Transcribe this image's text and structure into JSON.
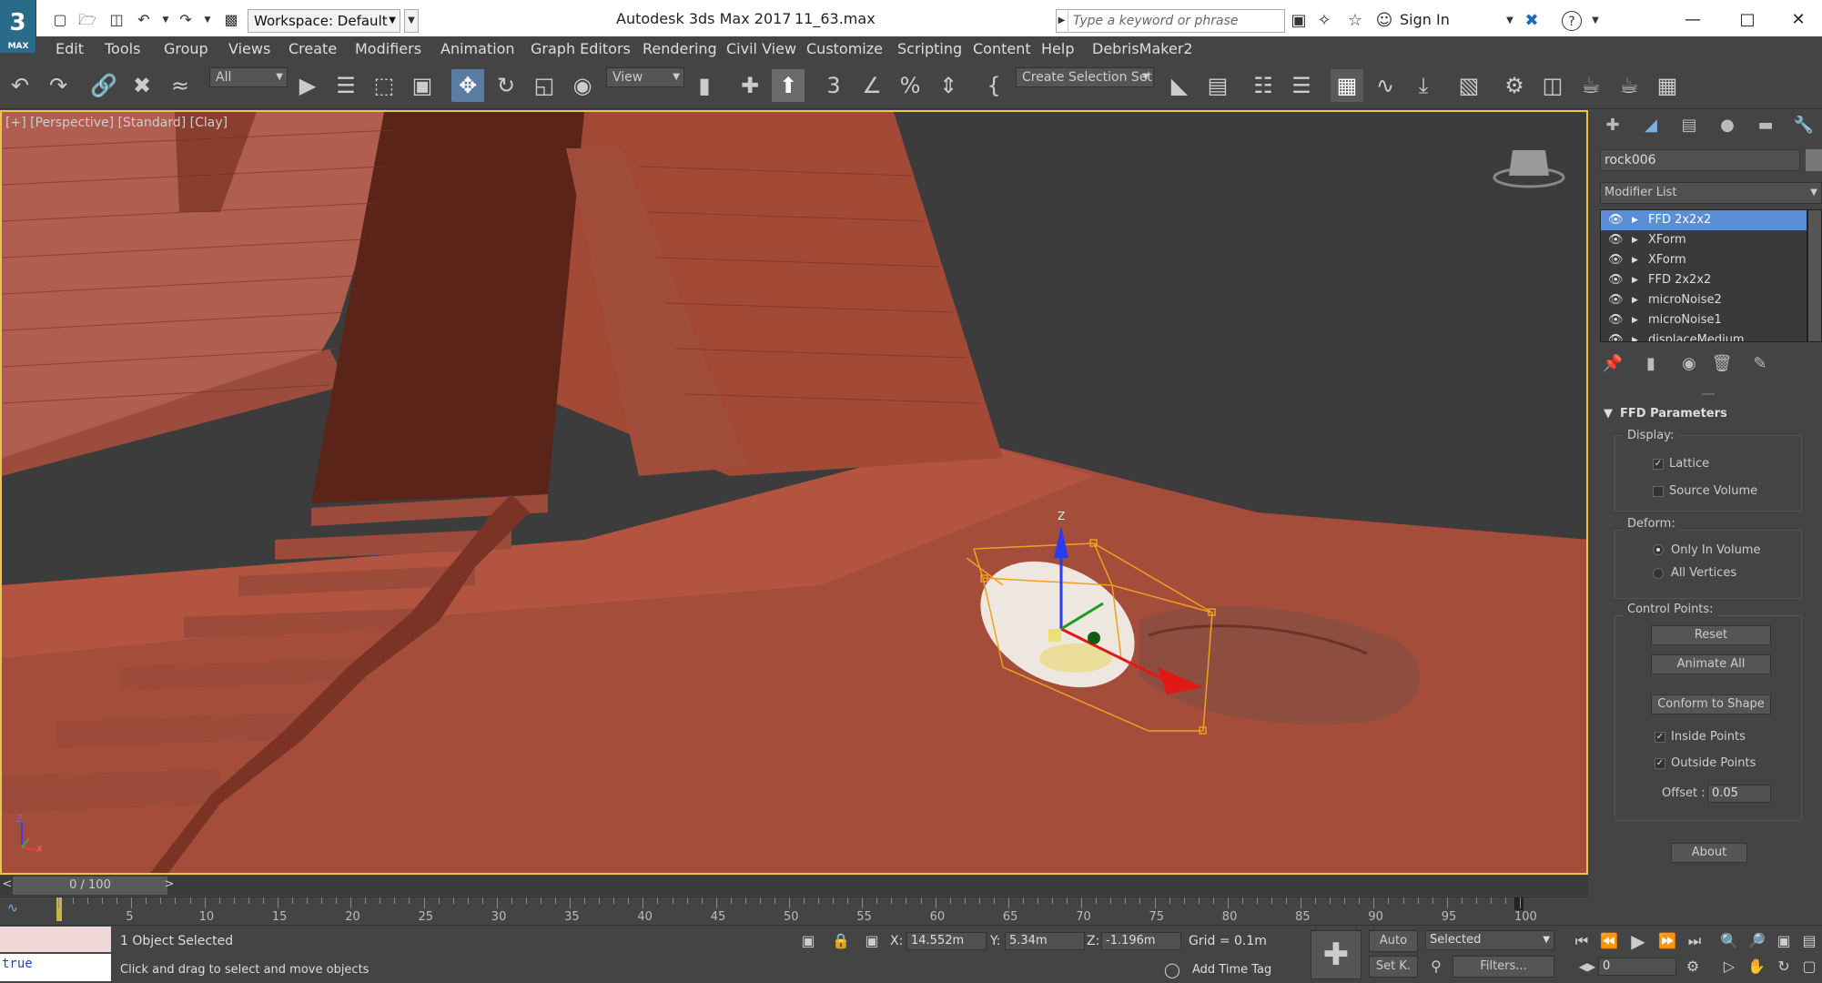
{
  "titlebar": {
    "app_logo": "3",
    "app_logo_sub": "MAX",
    "workspace": "Workspace: Default",
    "app_title": "Autodesk 3ds Max 2017",
    "file_name": "11_63.max",
    "search_placeholder": "Type a keyword or phrase",
    "sign_in": "Sign In",
    "help": "?"
  },
  "menu": [
    "Edit",
    "Tools",
    "Group",
    "Views",
    "Create",
    "Modifiers",
    "Animation",
    "Graph Editors",
    "Rendering",
    "Civil View",
    "Customize",
    "Scripting",
    "Content",
    "Help",
    "DebrisMaker2"
  ],
  "toolbar": {
    "filter": "All",
    "ref_coord": "View",
    "selection_set": "Create Selection Set",
    "active_tool": "select-and-move"
  },
  "viewport": {
    "label": "[+] [Perspective] [Standard] [Clay]",
    "gizmo_axis_z": "Z",
    "axis_tripod_z": "Z",
    "axis_tripod_x": "x"
  },
  "command_panel": {
    "object_name": "rock006",
    "modifier_list": "Modifier List",
    "stack": [
      {
        "name": "FFD 2x2x2",
        "selected": true
      },
      {
        "name": "XForm",
        "selected": false
      },
      {
        "name": "XForm",
        "selected": false
      },
      {
        "name": "FFD 2x2x2",
        "selected": false
      },
      {
        "name": "microNoise2",
        "selected": false
      },
      {
        "name": "microNoise1",
        "selected": false
      },
      {
        "name": "displaceMedium",
        "selected": false
      }
    ],
    "rollout_title": "FFD Parameters",
    "display_label": "Display:",
    "lattice": "Lattice",
    "lattice_checked": true,
    "source_volume": "Source Volume",
    "source_volume_checked": false,
    "deform_label": "Deform:",
    "only_in_volume": "Only In Volume",
    "all_vertices": "All Vertices",
    "deform_selected": "only_in_volume",
    "control_points_label": "Control Points:",
    "reset": "Reset",
    "animate_all": "Animate All",
    "conform_to_shape": "Conform to Shape",
    "inside_points": "Inside Points",
    "inside_points_checked": true,
    "outside_points": "Outside Points",
    "outside_points_checked": true,
    "offset_label": "Offset :",
    "offset_value": "0.05",
    "about": "About"
  },
  "timeline": {
    "frame_display": "0 / 100",
    "prev": "<",
    "next": ">",
    "ticks": [
      "5",
      "10",
      "15",
      "20",
      "25",
      "30",
      "35",
      "40",
      "45",
      "50",
      "55",
      "60",
      "65",
      "70",
      "75",
      "80",
      "85",
      "90",
      "95",
      "100"
    ],
    "current_frame": 0,
    "total_frames": 100
  },
  "status": {
    "listener_text": "true",
    "selection_info": "1 Object Selected",
    "prompt": "Click and drag to select and move objects",
    "x_label": "X:",
    "x_value": "14.552m",
    "y_label": "Y:",
    "y_value": "5.34m",
    "z_label": "Z:",
    "z_value": "-1.196m",
    "grid": "Grid = 0.1m",
    "add_time_tag": "Add Time Tag",
    "auto_key": "Auto",
    "set_key": "Set K.",
    "key_filter_selected": "Selected",
    "filters": "Filters...",
    "current_frame_field": "0"
  },
  "colors": {
    "accent": "#5a8ed6",
    "viewport_border": "#e8c64a",
    "clay": "#b8523f"
  }
}
